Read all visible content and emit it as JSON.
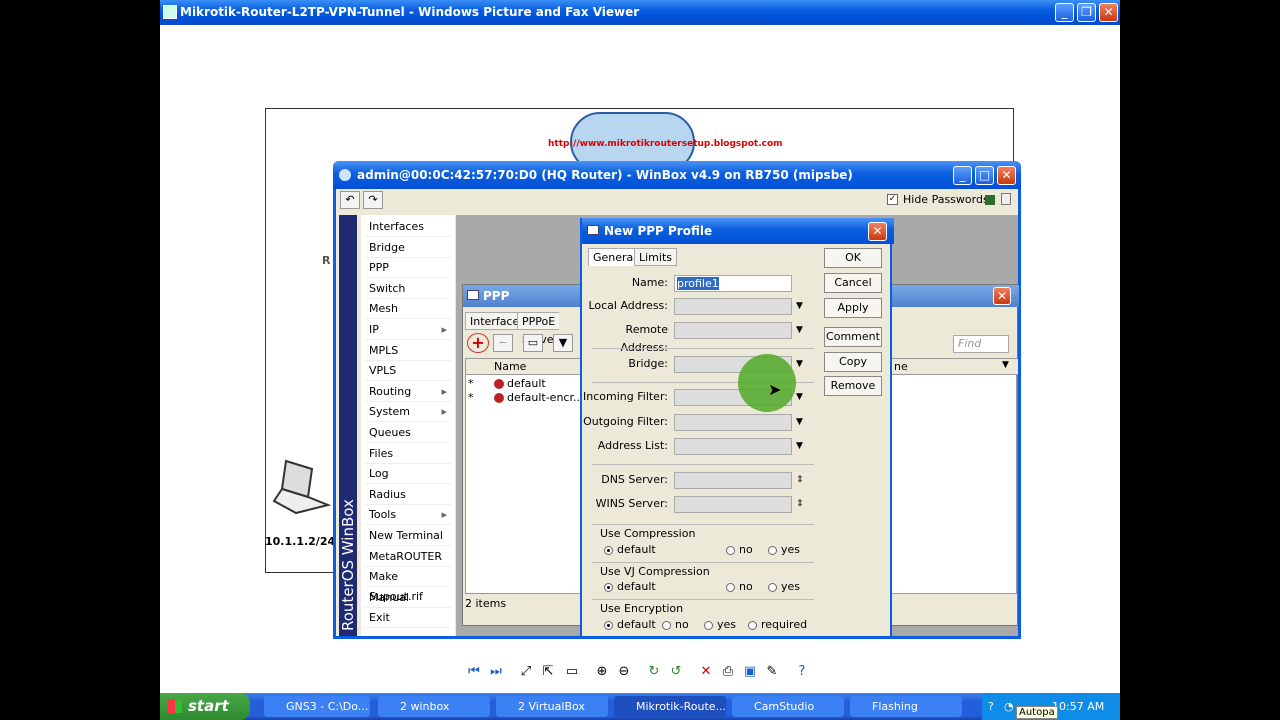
{
  "outer_window": {
    "title": "Mikrotik-Router-L2TP-VPN-Tunnel - Windows Picture and Fax Viewer"
  },
  "background_image": {
    "url_text": "http://www.mikrotikroutersetup.blogspot.com",
    "ip_label": "10.1.1.2/24",
    "partial_text": "R"
  },
  "winbox": {
    "title": "admin@00:0C:42:57:70:D0 (HQ Router) - WinBox v4.9 on RB750 (mipsbe)",
    "hide_passwords_label": "Hide Passwords",
    "brand": "RouterOS WinBox",
    "menu": [
      "Interfaces",
      "Bridge",
      "PPP",
      "Switch",
      "Mesh",
      "IP",
      "MPLS",
      "VPLS",
      "Routing",
      "System",
      "Queues",
      "Files",
      "Log",
      "Radius",
      "Tools",
      "New Terminal",
      "MetaROUTER",
      "Make Supout.rif",
      "Manual",
      "Exit"
    ]
  },
  "ppp": {
    "title": "PPP",
    "tabs": [
      "Interface",
      "PPPoE Serve"
    ],
    "find_placeholder": "Find",
    "col_name": "Name",
    "col_right": "ne",
    "rows": [
      {
        "flag": "*",
        "name": "default"
      },
      {
        "flag": "*",
        "name": "default-encr..."
      }
    ],
    "status": "2 items"
  },
  "new_profile": {
    "title": "New PPP Profile",
    "tabs": [
      "General",
      "Limits"
    ],
    "name_label": "Name:",
    "name_value": "profile1",
    "local_label": "Local Address:",
    "remote_label": "Remote Address:",
    "bridge_label": "Bridge:",
    "in_filter_label": "Incoming Filter:",
    "out_filter_label": "Outgoing Filter:",
    "addr_list_label": "Address List:",
    "dns_label": "DNS Server:",
    "wins_label": "WINS Server:",
    "compression": {
      "title": "Use Compression",
      "opts": [
        "default",
        "no",
        "yes"
      ]
    },
    "vj": {
      "title": "Use VJ Compression",
      "opts": [
        "default",
        "no",
        "yes"
      ]
    },
    "encryption": {
      "title": "Use Encryption",
      "opts": [
        "default",
        "no",
        "yes",
        "required"
      ]
    },
    "buttons": {
      "ok": "OK",
      "cancel": "Cancel",
      "apply": "Apply",
      "comment": "Comment",
      "copy": "Copy",
      "remove": "Remove"
    }
  },
  "taskbar": {
    "start": "start",
    "tasks": [
      "GNS3 - C:\\Do...",
      "2 winbox",
      "2 VirtualBox",
      "Mikrotik-Route...",
      "CamStudio",
      "Flashing"
    ],
    "clock": "10:57 AM",
    "tray_text": "Autopa"
  }
}
